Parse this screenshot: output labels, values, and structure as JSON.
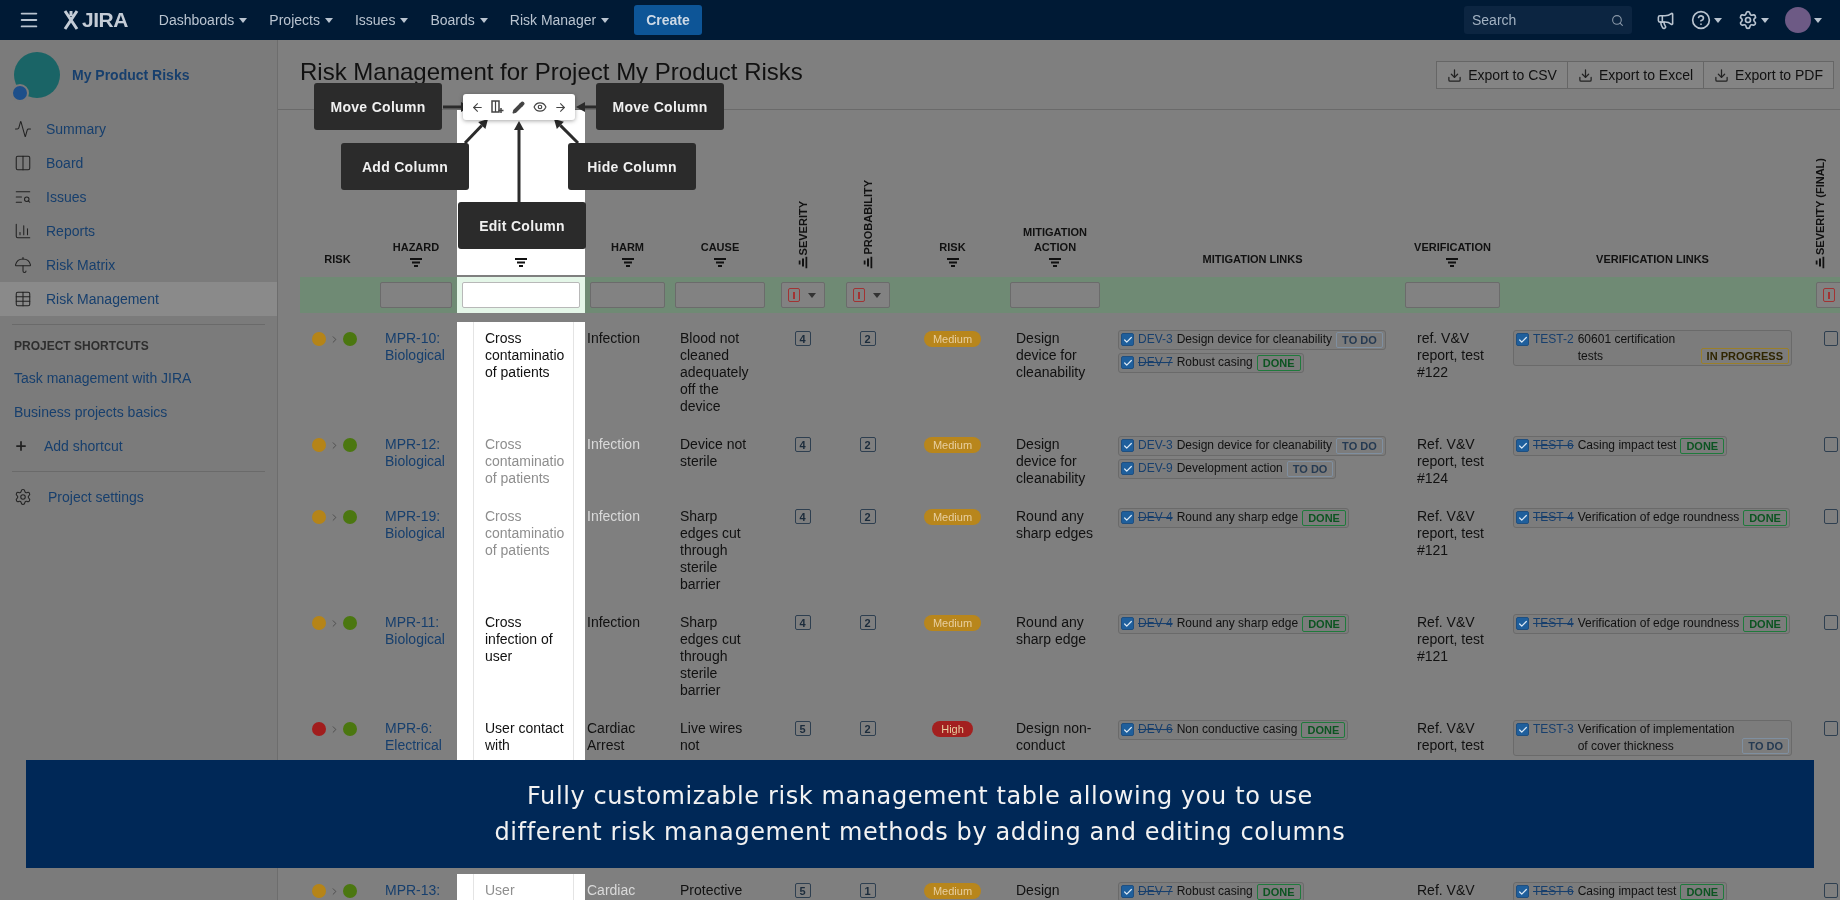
{
  "top_nav": {
    "logo": "JIRA",
    "menus": [
      {
        "label": "Dashboards"
      },
      {
        "label": "Projects"
      },
      {
        "label": "Issues"
      },
      {
        "label": "Boards"
      },
      {
        "label": "Risk Manager"
      }
    ],
    "create": "Create",
    "search": {
      "placeholder": "Search"
    }
  },
  "sidebar": {
    "project": "My Product Risks",
    "items": [
      {
        "label": "Summary",
        "selected": false
      },
      {
        "label": "Board",
        "selected": false
      },
      {
        "label": "Issues",
        "selected": false
      },
      {
        "label": "Reports",
        "selected": false
      },
      {
        "label": "Risk Matrix",
        "selected": false
      },
      {
        "label": "Risk Management",
        "selected": true
      }
    ],
    "shortcuts_heading": "PROJECT SHORTCUTS",
    "shortcuts": [
      "Task management with JIRA",
      "Business projects basics"
    ],
    "add_shortcut": "Add shortcut",
    "settings": "Project settings"
  },
  "page": {
    "title": "Risk Management for Project My Product Risks",
    "exports": [
      "Export to CSV",
      "Export to Excel",
      "Export to PDF"
    ]
  },
  "column_tools": {
    "callouts": [
      {
        "label": "Move Column",
        "kind": "move_left"
      },
      {
        "label": "Move Column",
        "kind": "move_right"
      },
      {
        "label": "Add Column",
        "kind": "add"
      },
      {
        "label": "Hide Column",
        "kind": "hide"
      },
      {
        "label": "Edit Column",
        "kind": "edit"
      }
    ]
  },
  "table": {
    "columns": [
      {
        "label": "RISK",
        "vertical": false,
        "filter_icon": false,
        "kind": "none",
        "highlighted": false
      },
      {
        "label": "HAZARD",
        "vertical": false,
        "filter_icon": true,
        "kind": "text",
        "highlighted": false
      },
      {
        "vertical": false,
        "filter_icon": true,
        "kind": "text",
        "highlighted": true
      },
      {
        "label": "HARM",
        "vertical": false,
        "filter_icon": true,
        "kind": "text",
        "highlighted": false
      },
      {
        "label": "CAUSE",
        "vertical": false,
        "filter_icon": true,
        "kind": "text",
        "highlighted": false
      },
      {
        "label": "SEVERITY",
        "vertical": true,
        "filter_icon": true,
        "kind": "select",
        "highlighted": false
      },
      {
        "label": "PROBABILITY",
        "vertical": true,
        "filter_icon": true,
        "kind": "select",
        "highlighted": false
      },
      {
        "label": "RISK",
        "vertical": false,
        "filter_icon": true,
        "kind": "none",
        "highlighted": false
      },
      {
        "label": "MITIGATION ACTION",
        "vertical": false,
        "filter_icon": true,
        "kind": "text",
        "highlighted": false
      },
      {
        "label": "MITIGATION LINKS",
        "vertical": false,
        "filter_icon": false,
        "kind": "none",
        "highlighted": false
      },
      {
        "label": "VERIFICATION",
        "vertical": false,
        "filter_icon": true,
        "kind": "text",
        "highlighted": false
      },
      {
        "label": "VERIFICATION LINKS",
        "vertical": false,
        "filter_icon": false,
        "kind": "none",
        "highlighted": false
      },
      {
        "label": "SEVERITY (FINAL)",
        "vertical": true,
        "filter_icon": true,
        "kind": "select",
        "highlighted": false
      }
    ],
    "rows": [
      {
        "risk_dots": [
          {
            "color": "#b58418"
          },
          {
            "color": "#4b7710"
          }
        ],
        "hazard": "MPR-10: Biological",
        "column_3": "Cross contaminatio of patients",
        "harm": "Infection",
        "cause": "Blood not cleaned adequately off the device",
        "severity": "4",
        "probability": "2",
        "risk": {
          "label": "Medium",
          "color": "#b8861c"
        },
        "mitigation_action": "Design device for cleanability",
        "mitigation_links": [
          {
            "key": "DEV-3",
            "title": "Design device for cleanability",
            "status": "TO DO",
            "kind": "todo",
            "resolved": false,
            "checked": true
          },
          {
            "key": "DEV-7",
            "title": "Robust casing",
            "status": "DONE",
            "kind": "done",
            "resolved": true,
            "checked": true
          }
        ],
        "verification": "ref. V&V report, test #122",
        "verification_links": [
          {
            "key": "TEST-2",
            "title": "60601 certification tests",
            "status": "IN PROGRESS",
            "kind": "inprogress",
            "resolved": false,
            "checked": true
          }
        ],
        "repeated": false
      },
      {
        "risk_dots": [
          {
            "color": "#b58418"
          },
          {
            "color": "#4b7710"
          }
        ],
        "hazard": "MPR-12: Biological",
        "column_3": "Cross contaminatio of patients",
        "harm": "Infection",
        "cause": "Device not sterile",
        "severity": "4",
        "probability": "2",
        "risk": {
          "label": "Medium",
          "color": "#b8861c"
        },
        "mitigation_action": "Design device for cleanability",
        "mitigation_links": [
          {
            "key": "DEV-3",
            "title": "Design device for cleanability",
            "status": "TO DO",
            "kind": "todo",
            "resolved": false,
            "checked": true
          },
          {
            "key": "DEV-9",
            "title": "Development action",
            "status": "TO DO",
            "kind": "todo",
            "resolved": false,
            "checked": true
          }
        ],
        "verification": "Ref. V&V report, test #124",
        "verification_links": [
          {
            "key": "TEST-6",
            "title": "Casing impact test",
            "status": "DONE",
            "kind": "done",
            "resolved": true,
            "checked": true
          }
        ],
        "repeated": true
      },
      {
        "risk_dots": [
          {
            "color": "#b58418"
          },
          {
            "color": "#4b7710"
          }
        ],
        "hazard": "MPR-19: Biological",
        "column_3": "Cross contaminatio of patients",
        "harm": "Infection",
        "cause": "Sharp edges cut through sterile barrier",
        "severity": "4",
        "probability": "2",
        "risk": {
          "label": "Medium",
          "color": "#b8861c"
        },
        "mitigation_action": "Round any sharp edges",
        "mitigation_links": [
          {
            "key": "DEV-4",
            "title": "Round any sharp edge",
            "status": "DONE",
            "kind": "done",
            "resolved": true,
            "checked": true
          }
        ],
        "verification": "Ref. V&V report, test #121",
        "verification_links": [
          {
            "key": "TEST-4",
            "title": "Verification of edge roundness",
            "status": "DONE",
            "kind": "done",
            "resolved": true,
            "checked": true
          }
        ],
        "repeated": true
      },
      {
        "risk_dots": [
          {
            "color": "#b58418"
          },
          {
            "color": "#4b7710"
          }
        ],
        "hazard": "MPR-11: Biological",
        "column_3": "Cross infection of user",
        "harm": "Infection",
        "cause": "Sharp edges cut through sterile barrier",
        "severity": "4",
        "probability": "2",
        "risk": {
          "label": "Medium",
          "color": "#b8861c"
        },
        "mitigation_action": "Round any sharp edge",
        "mitigation_links": [
          {
            "key": "DEV-4",
            "title": "Round any sharp edge",
            "status": "DONE",
            "kind": "done",
            "resolved": true,
            "checked": true
          }
        ],
        "verification": "Ref. V&V report, test #121",
        "verification_links": [
          {
            "key": "TEST-4",
            "title": "Verification of edge roundness",
            "status": "DONE",
            "kind": "done",
            "resolved": true,
            "checked": true
          }
        ],
        "repeated": false
      },
      {
        "risk_dots": [
          {
            "color": "#a11d1d"
          },
          {
            "color": "#4b7710"
          }
        ],
        "hazard": "MPR-6: Electrical",
        "column_3": "User contact with",
        "harm": "Cardiac Arrest",
        "cause": "Live wires not",
        "severity": "5",
        "probability": "2",
        "risk": {
          "label": "High",
          "color": "#a3201f"
        },
        "mitigation_action": "Design non-conduct",
        "mitigation_links": [
          {
            "key": "DEV-6",
            "title": "Non conductive casing",
            "status": "DONE",
            "kind": "done",
            "resolved": true,
            "checked": true
          }
        ],
        "verification": "Ref. V&V report, test",
        "verification_links": [
          {
            "key": "TEST-3",
            "title": "Verification of implementation of cover thickness",
            "status": "TO DO",
            "kind": "todo",
            "resolved": false,
            "checked": true
          }
        ],
        "repeated": false
      },
      {
        "risk_dots": [
          {
            "color": "#b58418"
          },
          {
            "color": "#4b7710"
          }
        ],
        "hazard": "MPR-13:",
        "column_3": "User",
        "harm": "Cardiac",
        "cause": "Protective",
        "severity": "5",
        "probability": "1",
        "risk": {
          "label": "Medium",
          "color": "#b8861c"
        },
        "mitigation_action": "Design",
        "mitigation_links": [
          {
            "key": "DEV-7",
            "title": "Robust casing",
            "status": "DONE",
            "kind": "done",
            "resolved": true,
            "checked": true
          }
        ],
        "verification": "Ref. V&V",
        "verification_links": [
          {
            "key": "TEST-6",
            "title": "Casing impact test",
            "status": "DONE",
            "kind": "done",
            "resolved": true,
            "checked": true
          }
        ],
        "repeated": true
      }
    ]
  },
  "banner": {
    "lines": [
      "Fully customizable risk management table allowing you to use",
      "different risk management methods by adding and editing columns"
    ]
  }
}
